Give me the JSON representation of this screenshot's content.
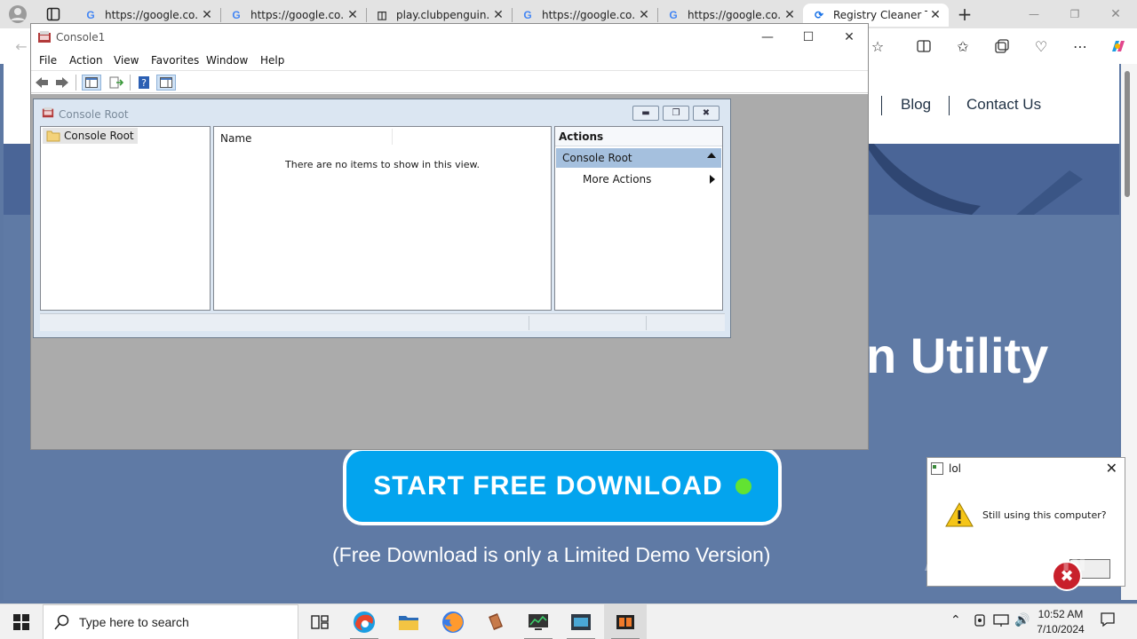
{
  "browser": {
    "tabs": [
      {
        "title": "https://google.co...",
        "favicon": "google-icon",
        "active": false
      },
      {
        "title": "https://google.co...",
        "favicon": "google-icon",
        "active": false
      },
      {
        "title": "play.clubpenguin...",
        "favicon": "page-icon",
        "active": false
      },
      {
        "title": "https://google.co...",
        "favicon": "google-icon",
        "active": false
      },
      {
        "title": "https://google.co...",
        "favicon": "google-icon",
        "active": false
      },
      {
        "title": "Registry Cleaner To",
        "favicon": "loading-icon",
        "active": true
      }
    ],
    "new_tab_symbol": "+",
    "minimize_symbol": "—",
    "restore_symbol": "❐",
    "close_symbol": "✕"
  },
  "webpage": {
    "nav_links": [
      "Blog",
      "Contact Us"
    ],
    "hero_title_fragment": "n Utility",
    "cta_label": "START FREE DOWNLOAD",
    "cta_note": "(Free Download is only a Limited Demo Version)",
    "colors": {
      "hero": "#5f7aa5",
      "cta": "#03a4ee",
      "cta_dot": "#62e332"
    }
  },
  "mmc": {
    "title": "Console1",
    "menu": [
      "File",
      "Action",
      "View",
      "Favorites",
      "Window",
      "Help"
    ],
    "toolbar": [
      "back-icon",
      "forward-icon",
      "show-tree-icon",
      "export-list-icon",
      "help-icon",
      "show-action-pane-icon"
    ],
    "child": {
      "title": "Console Root",
      "tree_item": "Console Root",
      "list_column": "Name",
      "empty_message": "There are no items to show in this view.",
      "actions_header": "Actions",
      "actions_selected": "Console Root",
      "actions_more": "More Actions"
    }
  },
  "dialog": {
    "title": "lol",
    "message": "Still using this computer?",
    "close_symbol": "✕"
  },
  "watermark": "ANY.RUN",
  "taskbar": {
    "search_placeholder": "Type here to search",
    "time": "10:52 AM",
    "date": "7/10/2024"
  }
}
